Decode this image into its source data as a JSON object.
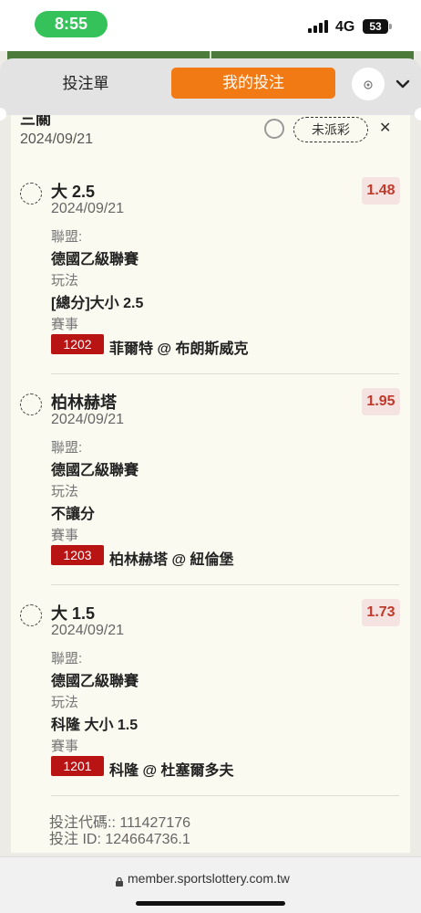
{
  "status_bar": {
    "time": "8:55",
    "network": "4G",
    "battery": "53"
  },
  "tabs": {
    "bet_slip": "投注單",
    "my_bets": "我的投注",
    "settings_icon": "gear-icon",
    "collapse_icon": "chevron-down-icon"
  },
  "partial_top": {
    "title": "三關",
    "date": "2024/09/21",
    "status": "未派彩"
  },
  "bets": [
    {
      "title": "大 2.5",
      "date": "2024/09/21",
      "odds": "1.48",
      "league_label": "聯盟:",
      "league": "德國乙級聯賽",
      "play_label": "玩法",
      "play": "[總分]大小 2.5",
      "event_label": "賽事",
      "event_no": "1202",
      "event": "菲爾特 @ 布朗斯威克"
    },
    {
      "title": "柏林赫塔",
      "date": "2024/09/21",
      "odds": "1.95",
      "league_label": "聯盟:",
      "league": "德國乙級聯賽",
      "play_label": "玩法",
      "play": "不讓分",
      "event_label": "賽事",
      "event_no": "1203",
      "event": "柏林赫塔 @ 紐倫堡"
    },
    {
      "title": "大 1.5",
      "date": "2024/09/21",
      "odds": "1.73",
      "league_label": "聯盟:",
      "league": "德國乙級聯賽",
      "play_label": "玩法",
      "play": "科隆 大小 1.5",
      "event_label": "賽事",
      "event_no": "1201",
      "event": "科隆 @ 杜塞爾多夫"
    }
  ],
  "footer": {
    "bet_code": "投注代碼:: 111427176",
    "bet_id": "投注 ID: 124664736.1"
  },
  "browser": {
    "url": "member.sportslottery.com.tw"
  },
  "colors": {
    "accent": "#f27a14",
    "odds_text": "#c0392b",
    "event_badge": "#b81414",
    "time_pill": "#36c25a"
  }
}
